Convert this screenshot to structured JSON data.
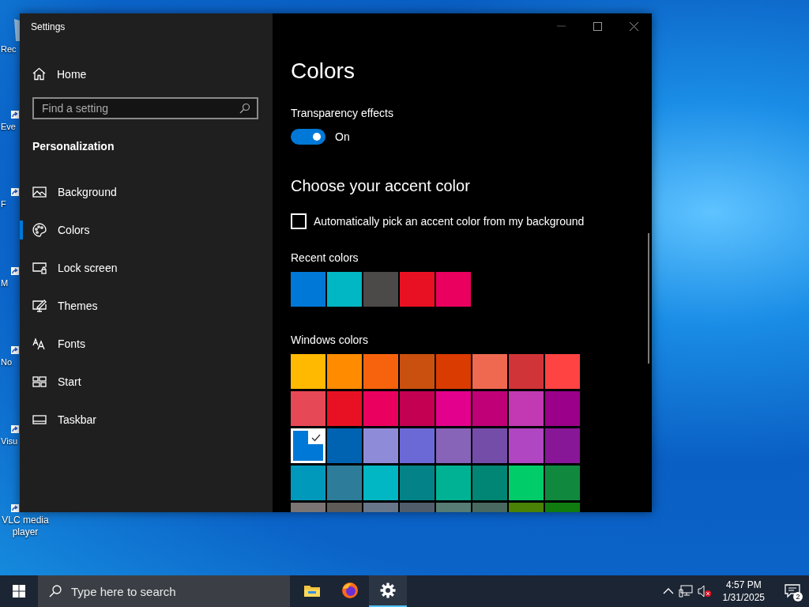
{
  "desktop_icons": [
    {
      "label": "Rec",
      "kind": "bin"
    },
    {
      "label": "Eve",
      "kind": "shortcut"
    },
    {
      "label": "F",
      "kind": "shortcut"
    },
    {
      "label": "M",
      "kind": "shortcut"
    },
    {
      "label": "No",
      "kind": "shortcut"
    },
    {
      "label": "Visu",
      "kind": "shortcut"
    },
    {
      "label": "VLC media player",
      "kind": "shortcut"
    }
  ],
  "window": {
    "title": "Settings"
  },
  "sidebar": {
    "home": "Home",
    "search": {
      "placeholder": "Find a setting"
    },
    "section": "Personalization",
    "items": [
      {
        "label": "Background",
        "selected": false
      },
      {
        "label": "Colors",
        "selected": true
      },
      {
        "label": "Lock screen",
        "selected": false
      },
      {
        "label": "Themes",
        "selected": false
      },
      {
        "label": "Fonts",
        "selected": false
      },
      {
        "label": "Start",
        "selected": false
      },
      {
        "label": "Taskbar",
        "selected": false
      }
    ]
  },
  "content": {
    "title": "Colors",
    "transparency": {
      "label": "Transparency effects",
      "on": true,
      "state_text": "On"
    },
    "accent_heading": "Choose your accent color",
    "auto_pick": {
      "label": "Automatically pick an accent color from my background",
      "checked": false
    },
    "recent_label": "Recent colors",
    "recent_colors": [
      {
        "color": "#0078d7",
        "selected": false
      },
      {
        "color": "#00b7c3",
        "selected": false
      },
      {
        "color": "#4c4a48",
        "selected": false
      },
      {
        "color": "#e81123",
        "selected": false
      },
      {
        "color": "#ea005e",
        "selected": false
      }
    ],
    "windows_label": "Windows colors",
    "windows_colors": [
      {
        "color": "#ffb900",
        "selected": false
      },
      {
        "color": "#ff8c00",
        "selected": false
      },
      {
        "color": "#f7630c",
        "selected": false
      },
      {
        "color": "#ca5010",
        "selected": false
      },
      {
        "color": "#da3b01",
        "selected": false
      },
      {
        "color": "#ef6950",
        "selected": false
      },
      {
        "color": "#d13438",
        "selected": false
      },
      {
        "color": "#ff4343",
        "selected": false
      },
      {
        "color": "#e74856",
        "selected": false
      },
      {
        "color": "#e81123",
        "selected": false
      },
      {
        "color": "#ea005e",
        "selected": false
      },
      {
        "color": "#c30052",
        "selected": false
      },
      {
        "color": "#e3008c",
        "selected": false
      },
      {
        "color": "#bf0077",
        "selected": false
      },
      {
        "color": "#c239b3",
        "selected": false
      },
      {
        "color": "#9a0089",
        "selected": false
      },
      {
        "color": "#0078d7",
        "selected": true
      },
      {
        "color": "#0063b1",
        "selected": false
      },
      {
        "color": "#8e8cd8",
        "selected": false
      },
      {
        "color": "#6b69d6",
        "selected": false
      },
      {
        "color": "#8764b8",
        "selected": false
      },
      {
        "color": "#744da9",
        "selected": false
      },
      {
        "color": "#b146c2",
        "selected": false
      },
      {
        "color": "#881798",
        "selected": false
      },
      {
        "color": "#0099bc",
        "selected": false
      },
      {
        "color": "#2d7d9a",
        "selected": false
      },
      {
        "color": "#00b7c3",
        "selected": false
      },
      {
        "color": "#038387",
        "selected": false
      },
      {
        "color": "#00b294",
        "selected": false
      },
      {
        "color": "#018574",
        "selected": false
      },
      {
        "color": "#00cc6a",
        "selected": false
      },
      {
        "color": "#10893e",
        "selected": false
      },
      {
        "color": "#7a7574",
        "selected": false
      },
      {
        "color": "#5d5a58",
        "selected": false
      },
      {
        "color": "#68768a",
        "selected": false
      },
      {
        "color": "#515c6b",
        "selected": false
      },
      {
        "color": "#567c73",
        "selected": false
      },
      {
        "color": "#486860",
        "selected": false
      },
      {
        "color": "#498205",
        "selected": false
      },
      {
        "color": "#107c10",
        "selected": false
      }
    ]
  },
  "taskbar": {
    "search": {
      "placeholder": "Type here to search"
    },
    "apps": [
      {
        "kind": "folder",
        "selected": false
      },
      {
        "kind": "browser",
        "selected": false
      },
      {
        "kind": "settings",
        "selected": true
      }
    ],
    "time": "4:57 PM",
    "date": "1/31/2025",
    "notifications": "2"
  }
}
